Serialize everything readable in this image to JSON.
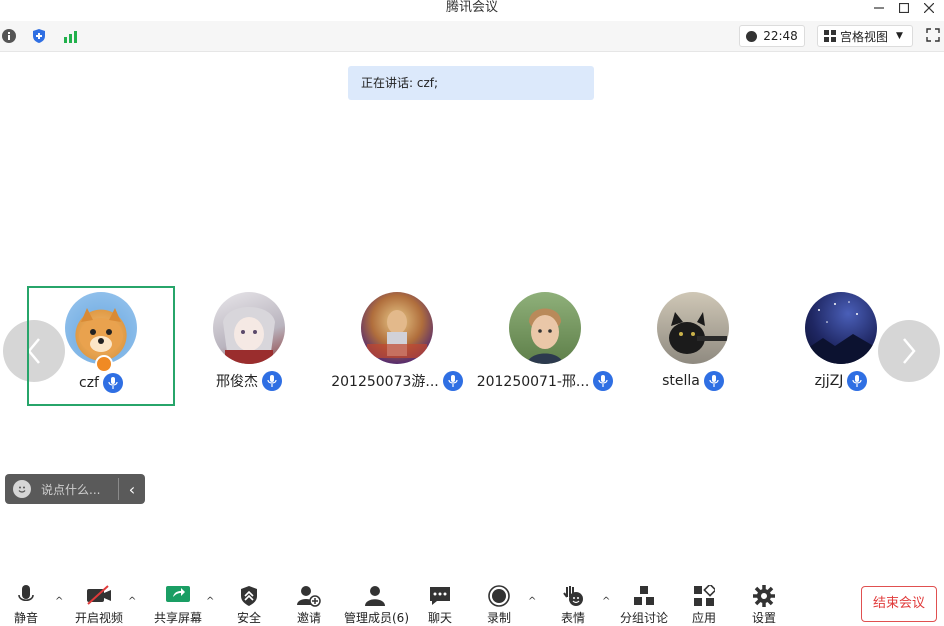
{
  "window": {
    "title": "腾讯会议"
  },
  "topbar": {
    "time": "22:48",
    "view_label": "宫格视图"
  },
  "speaking": {
    "text": "正在讲话: czf;"
  },
  "participants": [
    {
      "name": "czf",
      "host": true,
      "active": true,
      "avatar": "dog-avatar"
    },
    {
      "name": "邢俊杰",
      "avatar": "anime-avatar"
    },
    {
      "name": "201250073游...",
      "avatar": "colorful-avatar"
    },
    {
      "name": "201250071-邢...",
      "avatar": "person-avatar"
    },
    {
      "name": "stella",
      "avatar": "cat-avatar"
    },
    {
      "name": "zjjZJ",
      "avatar": "night-sky-avatar"
    }
  ],
  "chat": {
    "placeholder": "说点什么..."
  },
  "toolbar": {
    "items": [
      {
        "label": "静音",
        "icon": "microphone-icon"
      },
      {
        "label": "开启视频",
        "icon": "camera-off-icon"
      },
      {
        "label": "共享屏幕",
        "icon": "share-screen-icon"
      },
      {
        "label": "安全",
        "icon": "shield-icon"
      },
      {
        "label": "邀请",
        "icon": "invite-icon"
      },
      {
        "label": "管理成员(6)",
        "icon": "members-icon"
      },
      {
        "label": "聊天",
        "icon": "chat-icon"
      },
      {
        "label": "录制",
        "icon": "record-icon"
      },
      {
        "label": "表情",
        "icon": "emoji-icon"
      },
      {
        "label": "分组讨论",
        "icon": "breakout-icon"
      },
      {
        "label": "应用",
        "icon": "apps-icon"
      },
      {
        "label": "设置",
        "icon": "gear-icon"
      }
    ],
    "end_label": "结束会议"
  },
  "colors": {
    "accent": "#2f6fe3",
    "active_border": "#27a56a",
    "end": "#e03a3a",
    "speaking_bg": "#dce9fb"
  }
}
